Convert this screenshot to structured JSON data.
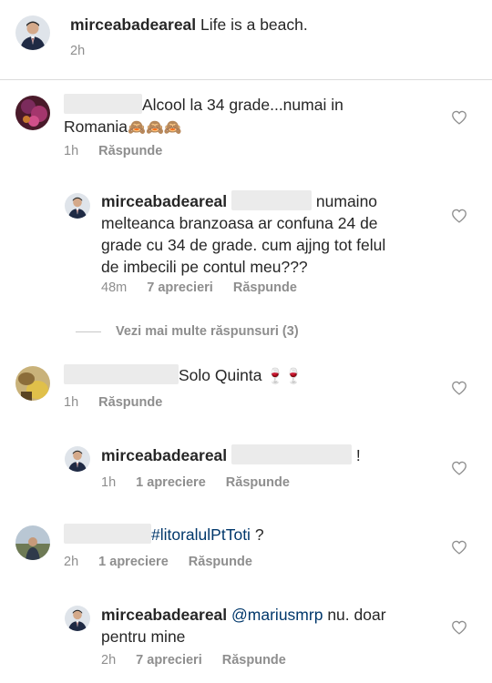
{
  "caption": {
    "username": "mirceabadeareal",
    "text": "Life is a beach.",
    "time": "2h"
  },
  "comments": [
    {
      "text_line1_tail": "Alcool la 34 grade...numai in",
      "text_line2": "Romania",
      "emoji": "🙈🙈🙈",
      "time": "1h",
      "reply_label": "Răspunde"
    },
    {
      "username": "mirceabadeareal",
      "text_line1_tail": "numaino",
      "text_line2": "melteanca branzoasa ar confuna 24 de",
      "text_line3": "grade cu 34 de grade. cum ajjng tot felul",
      "text_line4": "de imbecili pe contul meu???",
      "time": "48m",
      "likes": "7 aprecieri",
      "reply_label": "Răspunde"
    },
    {
      "view_more": "Vezi mai multe răspunsuri (3)"
    },
    {
      "text_tail": "Solo Quinta",
      "emoji": "🍷🍷",
      "time": "1h",
      "reply_label": "Răspunde"
    },
    {
      "username": "mirceabadeareal",
      "text_tail": "!",
      "time": "1h",
      "likes": "1 apreciere",
      "reply_label": "Răspunde"
    },
    {
      "hashtag": "#litoralulPtToti",
      "text_tail": "?",
      "time": "2h",
      "likes": "1 apreciere",
      "reply_label": "Răspunde"
    },
    {
      "username": "mirceabadeareal",
      "mention": "@mariusmrp",
      "text_line1_tail": "nu. doar",
      "text_line2": "pentru mine",
      "time": "2h",
      "likes": "7 aprecieri",
      "reply_label": "Răspunde"
    }
  ],
  "icons": {
    "like": "heart-outline-icon"
  },
  "colors": {
    "text": "#262626",
    "meta": "#8e8e8e",
    "link": "#00376b",
    "divider": "#dbdbdb"
  }
}
